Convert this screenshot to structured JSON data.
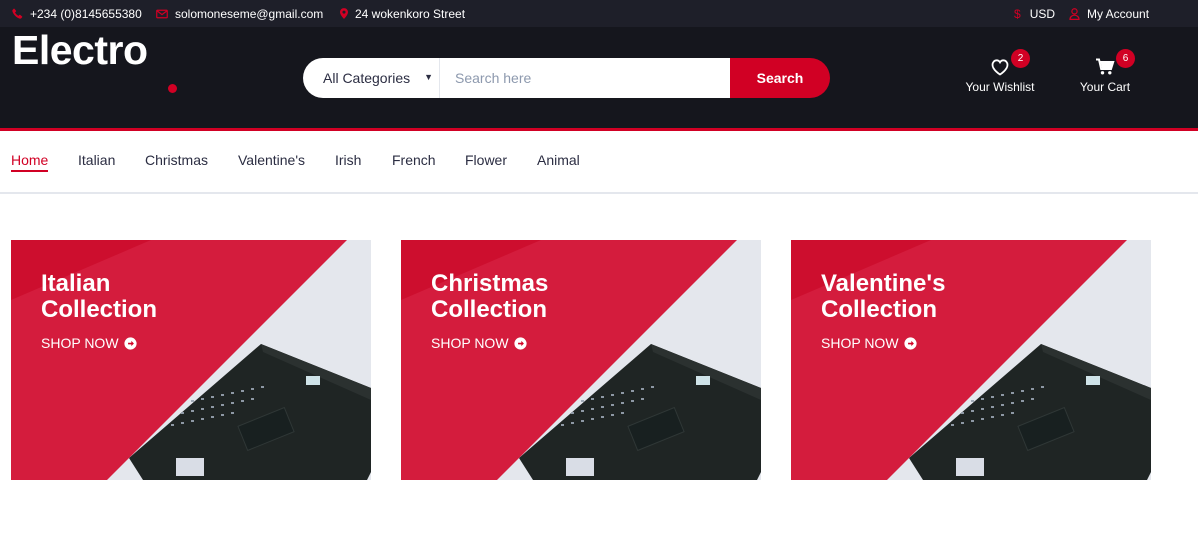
{
  "top_bar": {
    "phone": "+234 (0)8145655380",
    "email": "solomoneseme@gmail.com",
    "address": "24 wokenkoro Street",
    "currency": "USD",
    "account": "My Account"
  },
  "header": {
    "logo": "Electro",
    "search": {
      "category": "All Categories",
      "placeholder": "Search here",
      "button": "Search"
    },
    "wishlist": {
      "label": "Your Wishlist",
      "count": "2"
    },
    "cart": {
      "label": "Your Cart",
      "count": "6"
    }
  },
  "nav": {
    "items": [
      "Home",
      "Italian",
      "Christmas",
      "Valentine's",
      "Irish",
      "French",
      "Flower",
      "Animal"
    ],
    "active": "Home"
  },
  "collections": [
    {
      "line1": "Italian",
      "line2": "Collection",
      "cta": "SHOP NOW"
    },
    {
      "line1": "Christmas",
      "line2": "Collection",
      "cta": "SHOP NOW"
    },
    {
      "line1": "Valentine's",
      "line2": "Collection",
      "cta": "SHOP NOW"
    }
  ],
  "colors": {
    "accent": "#D10024",
    "top_bar": "#1E1F29",
    "header": "#15161D",
    "card_background": "#E4E7ED"
  },
  "icons": [
    "phone-icon",
    "envelope-icon",
    "map-marker-icon",
    "dollar-icon",
    "user-icon",
    "heart-icon",
    "shopping-cart-icon",
    "arrow-circle-right-icon"
  ]
}
